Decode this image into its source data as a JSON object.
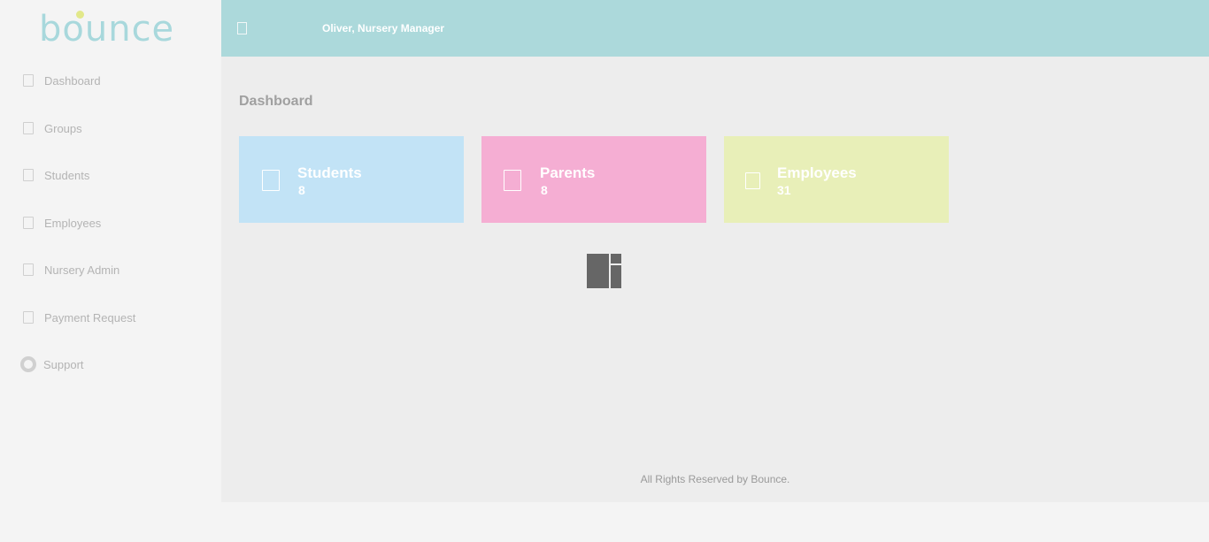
{
  "brand": {
    "logo_text": "bounce"
  },
  "sidebar": {
    "items": [
      {
        "label": "Dashboard",
        "icon": "dashboard-icon"
      },
      {
        "label": "Groups",
        "icon": "groups-icon"
      },
      {
        "label": "Students",
        "icon": "students-icon"
      },
      {
        "label": "Employees",
        "icon": "employees-icon"
      },
      {
        "label": "Nursery Admin",
        "icon": "nursery-admin-icon"
      },
      {
        "label": "Payment Request",
        "icon": "payment-request-icon"
      },
      {
        "label": "Support",
        "icon": "support-lifebuoy-icon"
      }
    ]
  },
  "header": {
    "user": "Oliver, Nursery Manager"
  },
  "main": {
    "title": "Dashboard",
    "cards": [
      {
        "label": "Students",
        "value": "8",
        "color": "#c2e3f6"
      },
      {
        "label": "Parents",
        "value": "8",
        "color": "#f5aed3"
      },
      {
        "label": "Employees",
        "value": "31",
        "color": "#e8efb8"
      }
    ]
  },
  "footer": {
    "text": "All Rights Reserved by Bounce."
  },
  "colors": {
    "topbar": "#acd9db",
    "sidebar": "#f4f4f4",
    "content": "#ededed"
  }
}
